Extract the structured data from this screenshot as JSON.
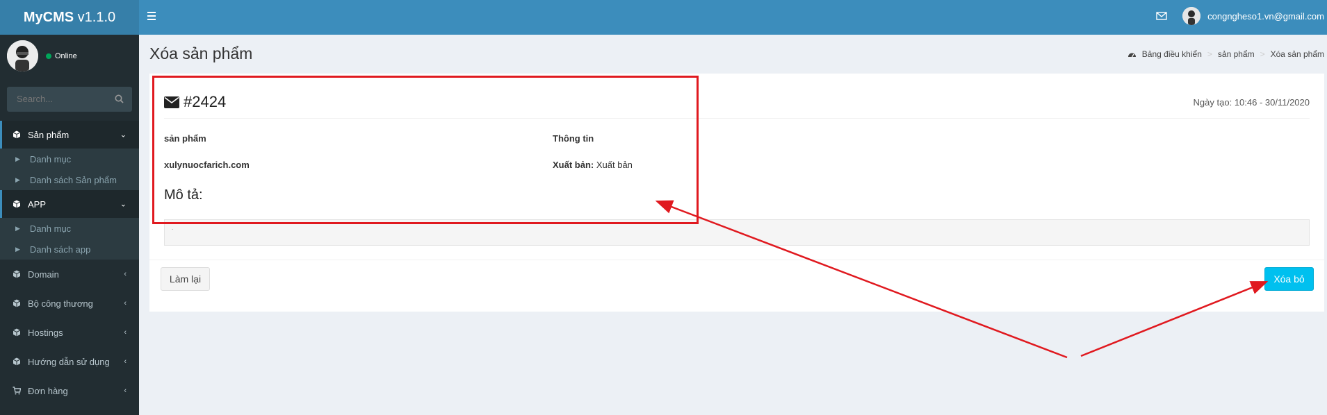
{
  "app": {
    "brand": "MyCMS",
    "version": "v1.1.0"
  },
  "header": {
    "user_email": "congngheso1.vn@gmail.com"
  },
  "user_panel": {
    "status": "Online"
  },
  "search": {
    "placeholder": "Search..."
  },
  "sidebar": {
    "items": [
      {
        "label": "Sản phẩm",
        "icon": "cube-icon",
        "expanded": true,
        "sub": [
          "Danh mục",
          "Danh sách Sản phẩm"
        ]
      },
      {
        "label": "APP",
        "icon": "cube-icon",
        "expanded": true,
        "sub": [
          "Danh mục",
          "Danh sách app"
        ]
      },
      {
        "label": "Domain",
        "icon": "cube-icon"
      },
      {
        "label": "Bộ công thương",
        "icon": "cube-icon"
      },
      {
        "label": "Hostings",
        "icon": "cube-icon"
      },
      {
        "label": "Hướng dẫn sử dụng",
        "icon": "cube-icon"
      },
      {
        "label": "Đơn hàng",
        "icon": "cart-icon"
      }
    ]
  },
  "page": {
    "title": "Xóa sản phẩm",
    "breadcrumb": [
      "Bảng điều khiển",
      "sản phẩm",
      "Xóa sản phẩm"
    ]
  },
  "record": {
    "id": "#2424",
    "created_label": "Ngày tạo:",
    "created_value": "10:46 - 30/11/2020",
    "col1_header": "sản phẩm",
    "col1_value": "xulynuocfarich.com",
    "col2_header": "Thông tin",
    "status_label": "Xuất bản:",
    "status_value": "Xuất bản",
    "desc_heading": "Mô tả:",
    "desc_content": "."
  },
  "actions": {
    "reset": "Làm lại",
    "delete": "Xóa bỏ"
  },
  "colors": {
    "header": "#3c8dbc",
    "logo": "#367fa9",
    "sidebar": "#222d32",
    "delete_button": "#00c0ef",
    "annotation": "#e0191f"
  }
}
